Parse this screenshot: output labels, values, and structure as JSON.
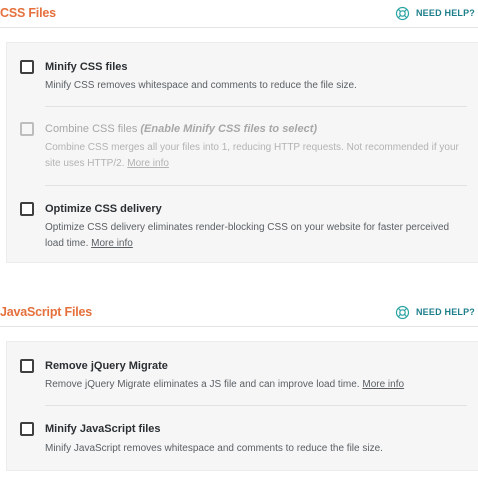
{
  "css_section": {
    "title": "CSS Files",
    "help_label": "NEED HELP?",
    "options": [
      {
        "title": "Minify CSS files",
        "description": "Minify CSS removes whitespace and comments to reduce the file size.",
        "checked": false,
        "disabled": false
      },
      {
        "title": "Combine CSS files",
        "hint": "(Enable Minify CSS files to select)",
        "description": "Combine CSS merges all your files into 1, reducing HTTP requests. Not recommended if your site uses HTTP/2.",
        "link": "More info",
        "checked": false,
        "disabled": true
      },
      {
        "title": "Optimize CSS delivery",
        "description": "Optimize CSS delivery eliminates render-blocking CSS on your website for faster perceived load time.",
        "link": "More info",
        "checked": false,
        "disabled": false
      }
    ]
  },
  "js_section": {
    "title": "JavaScript Files",
    "help_label": "NEED HELP?",
    "options": [
      {
        "title": "Remove jQuery Migrate",
        "description": "Remove jQuery Migrate eliminates a JS file and can improve load time.",
        "link": "More info",
        "checked": false,
        "disabled": false
      },
      {
        "title": "Minify JavaScript files",
        "description": "Minify JavaScript removes whitespace and comments to reduce the file size.",
        "checked": false,
        "disabled": false
      }
    ]
  },
  "colors": {
    "section_title": "#e5703c",
    "help_link": "#1d7e8b",
    "panel_background": "#f6f6f6"
  },
  "icons": {
    "help": "lifebuoy-icon"
  }
}
